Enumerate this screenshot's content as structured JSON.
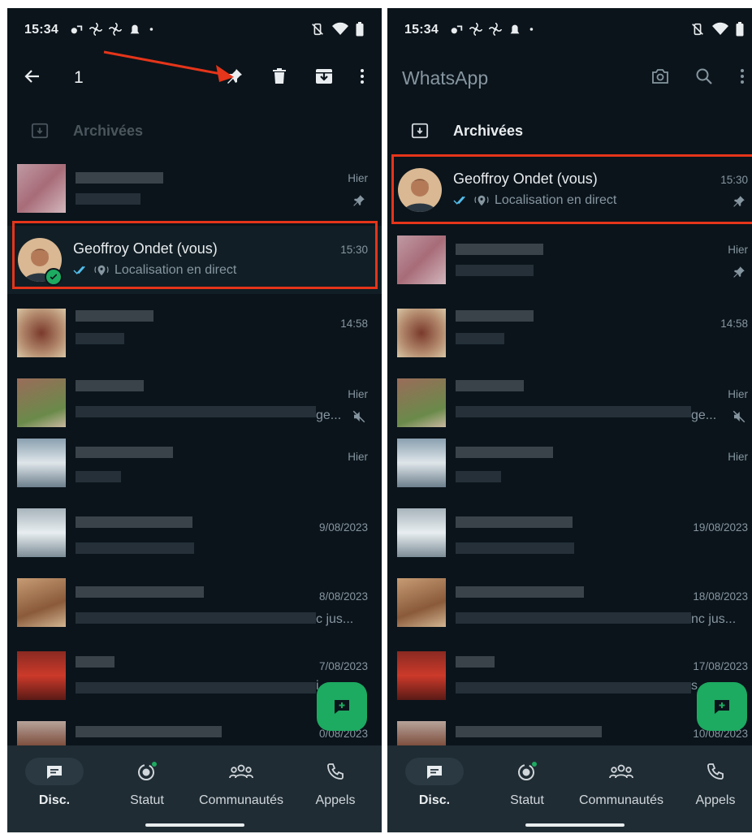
{
  "status_bar": {
    "time": "15:34"
  },
  "left_screen": {
    "selection_count": "1",
    "archive_label": "Archivées",
    "pinned_chat": {
      "name": "Geoffroy Ondet (vous)",
      "preview": "Localisation en direct",
      "time": "15:30"
    },
    "chat_times": [
      "Hier",
      "14:58",
      "Hier",
      "Hier",
      "9/08/2023",
      "8/08/2023",
      "7/08/2023",
      "0/08/2023"
    ],
    "fragments": [
      "ge...",
      "c jus...",
      "i"
    ]
  },
  "right_screen": {
    "app_title": "WhatsApp",
    "archive_label": "Archivées",
    "pinned_chat": {
      "name": "Geoffroy Ondet (vous)",
      "preview": "Localisation en direct",
      "time": "15:30"
    },
    "chat_times": [
      "Hier",
      "14:58",
      "Hier",
      "Hier",
      "19/08/2023",
      "18/08/2023",
      "17/08/2023",
      "10/08/2023"
    ],
    "fragments": [
      "ge...",
      "nc jus...",
      "s"
    ]
  },
  "bottom_nav": {
    "items": [
      {
        "label": "Disc.",
        "icon": "chats-icon",
        "active": true
      },
      {
        "label": "Statut",
        "icon": "status-icon",
        "active": false
      },
      {
        "label": "Communautés",
        "icon": "communities-icon",
        "active": false
      },
      {
        "label": "Appels",
        "icon": "calls-icon",
        "active": false
      }
    ]
  },
  "colors": {
    "background": "#0b141b",
    "bar": "#1f2c34",
    "accent": "#1daa61",
    "highlight": "#e5351a",
    "read_ticks": "#53bdeb"
  }
}
